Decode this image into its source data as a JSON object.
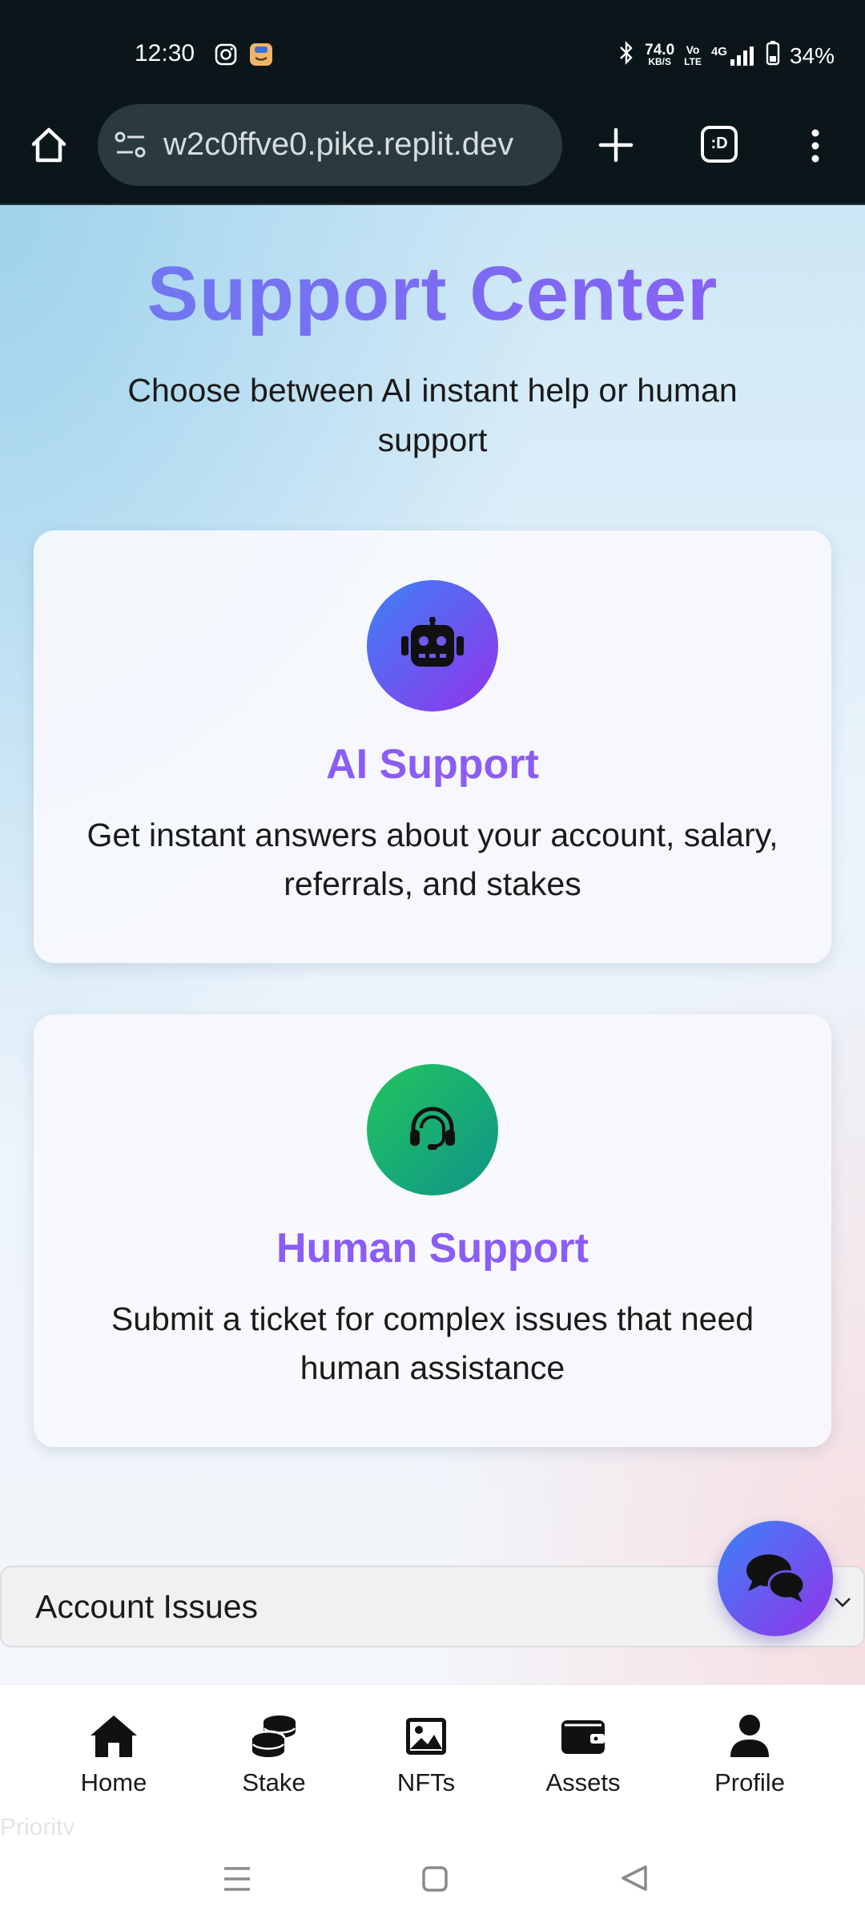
{
  "status_bar": {
    "time": "12:30",
    "net_speed_value": "74.0",
    "net_speed_unit": "KB/S",
    "volte_top": "Vo",
    "volte_bottom": "LTE",
    "network": "4G",
    "battery": "34%",
    "icons": [
      "instagram-icon",
      "app-notification-icon",
      "bluetooth-icon",
      "signal-icon",
      "battery-icon"
    ]
  },
  "browser": {
    "url": "w2c0ffve0.pike.replit.dev",
    "tab_switcher_label": ":D",
    "icons": [
      "home-icon",
      "site-settings-icon",
      "new-tab-icon",
      "tab-switcher-icon",
      "more-menu-icon"
    ]
  },
  "page": {
    "title": "Support Center",
    "subtitle": "Choose between AI instant help or human support",
    "cards": [
      {
        "title": "AI Support",
        "description": "Get instant answers about your account, salary, referrals, and stakes",
        "icon": "robot-icon"
      },
      {
        "title": "Human Support",
        "description": "Submit a ticket for complex issues that need human assistance",
        "icon": "headset-icon"
      }
    ],
    "category_select": {
      "selected": "Account Issues"
    },
    "partial_label": "Priority",
    "colors": {
      "title_gradient_start": "#6b7cf0",
      "title_gradient_end": "#8b5cf6",
      "card_title": "#8b5cf6",
      "ai_gradient_start": "#3b82f6",
      "ai_gradient_end": "#9333ea",
      "human_gradient_start": "#22c55e",
      "human_gradient_end": "#0f9488"
    }
  },
  "bottom_nav": {
    "items": [
      {
        "label": "Home",
        "icon": "home-icon"
      },
      {
        "label": "Stake",
        "icon": "coins-icon"
      },
      {
        "label": "NFTs",
        "icon": "image-icon"
      },
      {
        "label": "Assets",
        "icon": "wallet-icon"
      },
      {
        "label": "Profile",
        "icon": "user-icon"
      }
    ]
  },
  "system_nav": [
    "recents-icon",
    "home-button-icon",
    "back-icon"
  ]
}
